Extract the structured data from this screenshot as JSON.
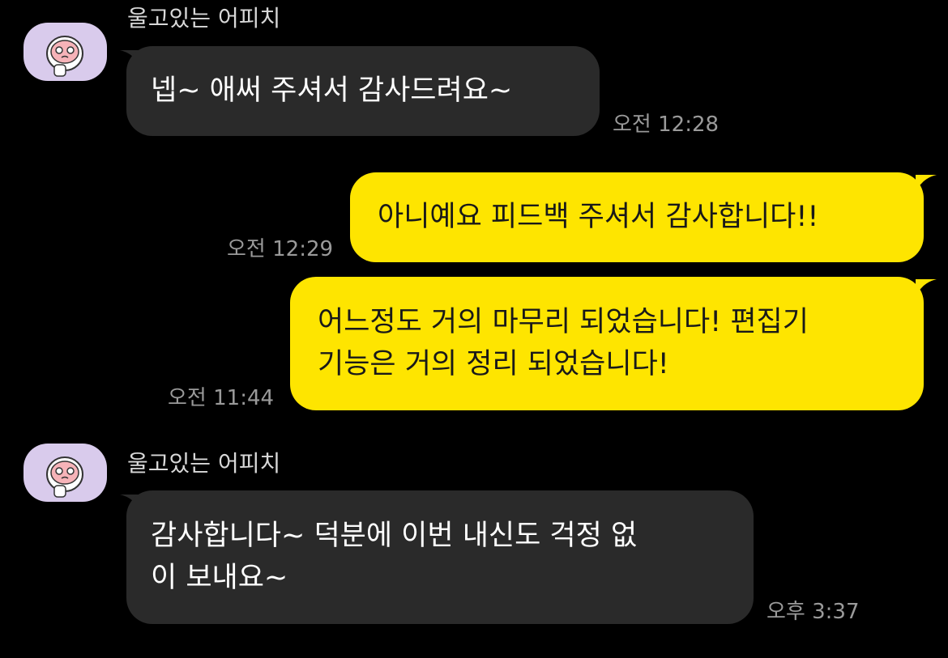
{
  "colors": {
    "background": "#000000",
    "incoming_bubble": "#2a2a2a",
    "outgoing_bubble": "#fee500",
    "avatar_bg": "#d9cbec",
    "timestamp": "#9a9a9a"
  },
  "messages": [
    {
      "direction": "incoming",
      "sender": "울고있는 어피치",
      "avatar_icon": "crying-apeach-avatar-icon",
      "text": "넵~ 애써 주셔서 감사드려요~",
      "time": "오전 12:28"
    },
    {
      "direction": "outgoing",
      "text": "아니예요 피드백 주셔서 감사합니다!!",
      "time": "오전 12:29"
    },
    {
      "direction": "outgoing",
      "text": "어느정도 거의 마무리 되었습니다! 편집기\n기능은 거의 정리 되었습니다!",
      "time": "오전 11:44"
    },
    {
      "direction": "incoming",
      "sender": "울고있는 어피치",
      "avatar_icon": "crying-apeach-avatar-icon",
      "text": "감사합니다~ 덕분에 이번 내신도 걱정 없\n이 보내요~",
      "time": "오후 3:37"
    }
  ]
}
